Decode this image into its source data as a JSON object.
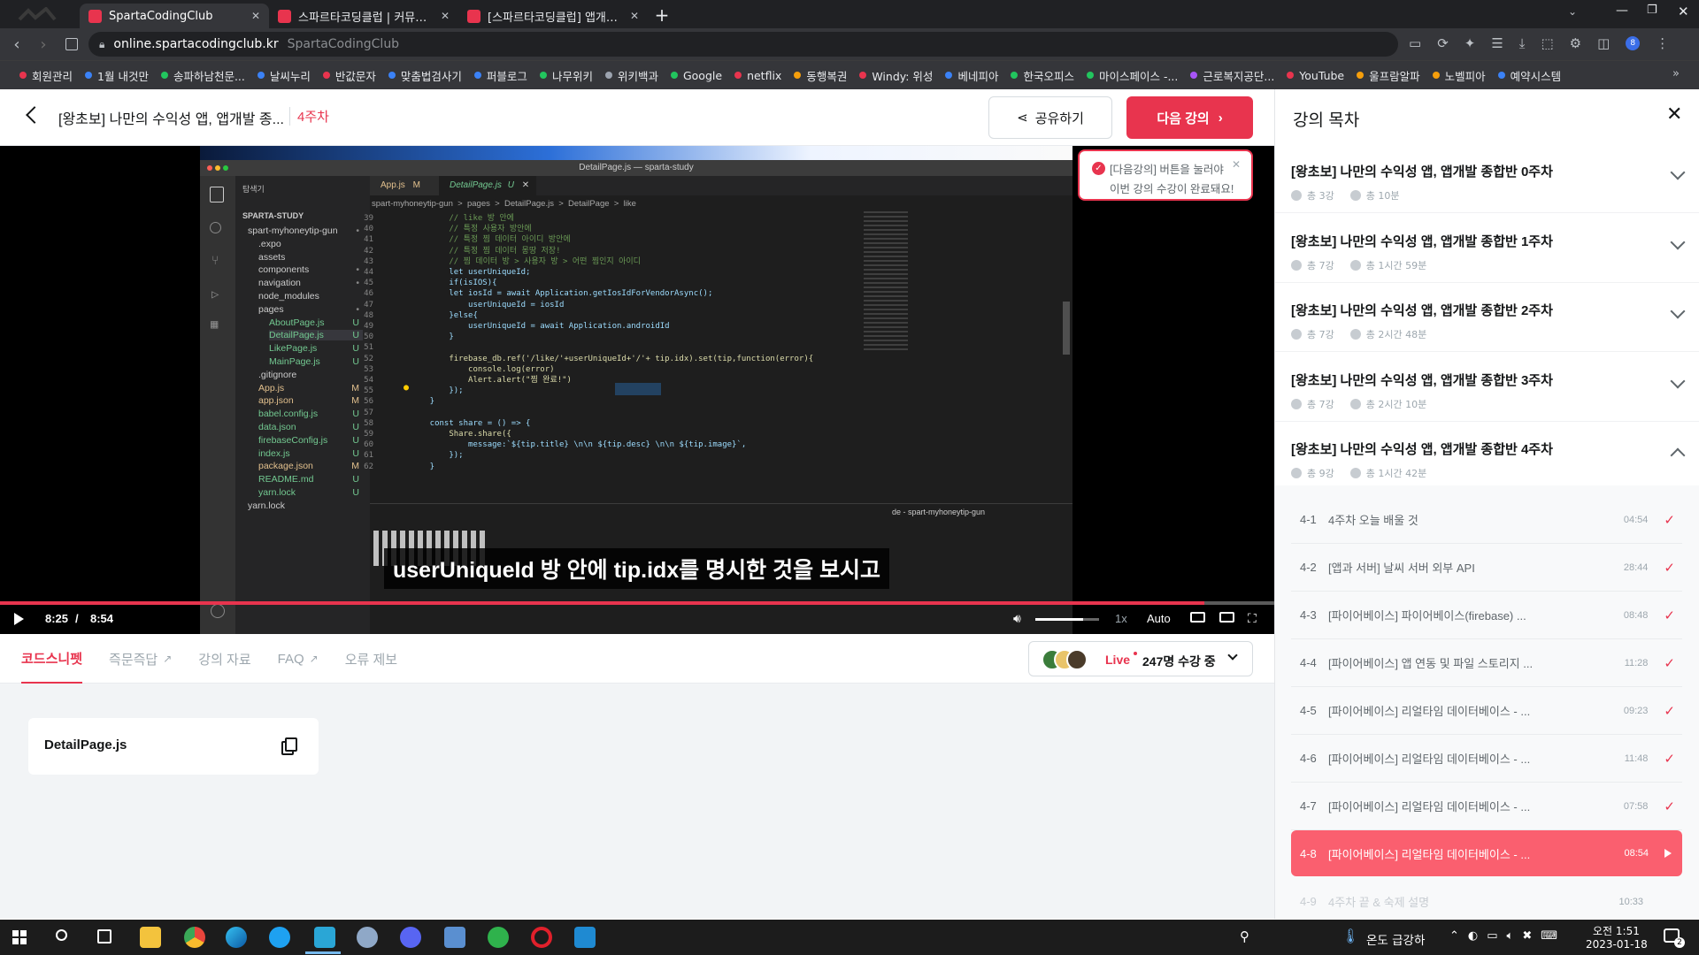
{
  "browser": {
    "tabs": [
      {
        "title": "SpartaCodingClub",
        "active": true,
        "color": "#e8344e"
      },
      {
        "title": "스파르타코딩클럽 | 커뮤니티",
        "active": false,
        "color": "#e8344e"
      },
      {
        "title": "[스파르타코딩클럽] 앱개발 종합",
        "active": false,
        "color": "#e8344e"
      }
    ],
    "url_domain": "online.spartacodingclub.kr",
    "url_site": "SpartaCodingClub",
    "profile_badge": "8",
    "bookmarks": [
      {
        "label": "회원관리",
        "color": "#e8344e"
      },
      {
        "label": "1월 내것만",
        "color": "#3b82f6"
      },
      {
        "label": "송파하남천문...",
        "color": "#22c55e"
      },
      {
        "label": "날씨누리",
        "color": "#3b82f6"
      },
      {
        "label": "반값문자",
        "color": "#e8344e"
      },
      {
        "label": "맞춤법검사기",
        "color": "#3b82f6"
      },
      {
        "label": "퍼블로그",
        "color": "#3b82f6"
      },
      {
        "label": "나무위키",
        "color": "#22c55e"
      },
      {
        "label": "위키백과",
        "color": "#9ca3af"
      },
      {
        "label": "Google",
        "color": "#22c55e"
      },
      {
        "label": "netflix",
        "color": "#e8344e"
      },
      {
        "label": "동행복권",
        "color": "#f59e0b"
      },
      {
        "label": "Windy: 위성",
        "color": "#e8344e"
      },
      {
        "label": "베네피아",
        "color": "#3b82f6"
      },
      {
        "label": "한국오피스",
        "color": "#22c55e"
      },
      {
        "label": "마이스페이스 -...",
        "color": "#22c55e"
      },
      {
        "label": "근로복지공단...",
        "color": "#a855f7"
      },
      {
        "label": "YouTube",
        "color": "#e8344e"
      },
      {
        "label": "울프람알파",
        "color": "#f59e0b"
      },
      {
        "label": "노벨피아",
        "color": "#f59e0b"
      },
      {
        "label": "예약시스템",
        "color": "#3b82f6"
      }
    ]
  },
  "header": {
    "course_title": "[왕초보] 나만의 수익성 앱, 앱개발 종...",
    "week_label": "4주차",
    "share_label": "공유하기",
    "next_label": "다음 강의"
  },
  "tooltip": {
    "line1": "[다음강의] 버튼을 눌러야",
    "line2": "이번 강의 수강이 완료돼요!"
  },
  "vscode": {
    "window_title": "DetailPage.js — sparta-study",
    "explorer_label": "탐색기",
    "project": "SPARTA-STUDY",
    "tabs": [
      {
        "name": "App.js",
        "mark": "M"
      },
      {
        "name": "DetailPage.js",
        "mark": "U"
      }
    ],
    "breadcrumb": "spart-myhoneytip-gun  >  pages  >  DetailPage.js  >  DetailPage  >  like",
    "tree": [
      {
        "name": "spart-myhoneytip-gun",
        "indent": 0,
        "badge": "•"
      },
      {
        "name": ".expo",
        "indent": 1,
        "badge": ""
      },
      {
        "name": "assets",
        "indent": 1,
        "badge": ""
      },
      {
        "name": "components",
        "indent": 1,
        "badge": "•"
      },
      {
        "name": "navigation",
        "indent": 1,
        "badge": "•"
      },
      {
        "name": "node_modules",
        "indent": 1,
        "badge": ""
      },
      {
        "name": "pages",
        "indent": 1,
        "badge": "•"
      },
      {
        "name": "AboutPage.js",
        "indent": 2,
        "badge": "U"
      },
      {
        "name": "DetailPage.js",
        "indent": 2,
        "badge": "U"
      },
      {
        "name": "LikePage.js",
        "indent": 2,
        "badge": "U"
      },
      {
        "name": "MainPage.js",
        "indent": 2,
        "badge": "U"
      },
      {
        "name": ".gitignore",
        "indent": 1,
        "badge": ""
      },
      {
        "name": "App.js",
        "indent": 1,
        "badge": "M"
      },
      {
        "name": "app.json",
        "indent": 1,
        "badge": "M"
      },
      {
        "name": "babel.config.js",
        "indent": 1,
        "badge": "U"
      },
      {
        "name": "data.json",
        "indent": 1,
        "badge": "U"
      },
      {
        "name": "firebaseConfig.js",
        "indent": 1,
        "badge": "U"
      },
      {
        "name": "index.js",
        "indent": 1,
        "badge": "U"
      },
      {
        "name": "package.json",
        "indent": 1,
        "badge": "M"
      },
      {
        "name": "README.md",
        "indent": 1,
        "badge": "U"
      },
      {
        "name": "yarn.lock",
        "indent": 1,
        "badge": "U"
      },
      {
        "name": "yarn.lock",
        "indent": 0,
        "badge": ""
      }
    ],
    "code": [
      {
        "n": "39",
        "text": "        // like 방 안에"
      },
      {
        "n": "40",
        "text": "        // 특정 사용자 방안에"
      },
      {
        "n": "41",
        "text": "        // 특정 찜 데이터 아이디 방안에"
      },
      {
        "n": "42",
        "text": "        // 특정 찜 데이터 몽땅 저장!"
      },
      {
        "n": "43",
        "text": "        // 찜 데이터 방 > 사용자 방 > 어떤 찜인지 아이디"
      },
      {
        "n": "44",
        "text": "        let userUniqueId;"
      },
      {
        "n": "45",
        "text": "        if(isIOS){"
      },
      {
        "n": "46",
        "text": "        let iosId = await Application.getIosIdForVendorAsync();"
      },
      {
        "n": "47",
        "text": "            userUniqueId = iosId"
      },
      {
        "n": "48",
        "text": "        }else{"
      },
      {
        "n": "49",
        "text": "            userUniqueId = await Application.androidId"
      },
      {
        "n": "50",
        "text": "        }"
      },
      {
        "n": "51",
        "text": ""
      },
      {
        "n": "52",
        "text": "        firebase_db.ref('/like/'+userUniqueId+'/'+ tip.idx).set(tip,function(error){"
      },
      {
        "n": "53",
        "text": "            console.log(error)"
      },
      {
        "n": "54",
        "text": "            Alert.alert(\"찜 완료!\")"
      },
      {
        "n": "55",
        "text": "        });"
      },
      {
        "n": "56",
        "text": "    }"
      },
      {
        "n": "57",
        "text": ""
      },
      {
        "n": "58",
        "text": "    const share = () => {"
      },
      {
        "n": "59",
        "text": "        Share.share({"
      },
      {
        "n": "60",
        "text": "            message:`${tip.title} \\n\\n ${tip.desc} \\n\\n ${tip.image}`,"
      },
      {
        "n": "61",
        "text": "        });"
      },
      {
        "n": "62",
        "text": "    }"
      }
    ],
    "terminal_label": "de - spart-myhoneytip-gun"
  },
  "player": {
    "subtitle": "userUniqueId 방 안에 tip.idx를 명시한 것을 보시고",
    "current_time": "8:25",
    "separator": "/",
    "duration": "8:54",
    "progress": 0.945,
    "volume": 0.75,
    "speed": "1x",
    "quality": "Auto"
  },
  "lower_tabs": [
    {
      "label": "코드스니펫",
      "active": true,
      "external": false
    },
    {
      "label": "즉문즉답",
      "active": false,
      "external": true
    },
    {
      "label": "강의 자료",
      "active": false,
      "external": false
    },
    {
      "label": "FAQ",
      "active": false,
      "external": true
    },
    {
      "label": "오류 제보",
      "active": false,
      "external": false
    }
  ],
  "live": {
    "badge": "Live",
    "count_text": "247명 수강 중"
  },
  "snippet": {
    "filename": "DetailPage.js"
  },
  "sidebar": {
    "title": "강의 목차",
    "weeks": [
      {
        "title": "[왕초보] 나만의 수익성 앱, 앱개발 종합반 0주차",
        "lessons": "총 3강",
        "duration": "총 10분",
        "expanded": false
      },
      {
        "title": "[왕초보] 나만의 수익성 앱, 앱개발 종합반 1주차",
        "lessons": "총 7강",
        "duration": "총 1시간 59분",
        "expanded": false
      },
      {
        "title": "[왕초보] 나만의 수익성 앱, 앱개발 종합반 2주차",
        "lessons": "총 7강",
        "duration": "총 2시간 48분",
        "expanded": false
      },
      {
        "title": "[왕초보] 나만의 수익성 앱, 앱개발 종합반 3주차",
        "lessons": "총 7강",
        "duration": "총 2시간 10분",
        "expanded": false
      },
      {
        "title": "[왕초보] 나만의 수익성 앱, 앱개발 종합반 4주차",
        "lessons": "총 9강",
        "duration": "총 1시간 42분",
        "expanded": true
      }
    ],
    "lectures": [
      {
        "num": "4-1",
        "title": "4주차 오늘 배울 것",
        "duration": "04:54",
        "state": "done"
      },
      {
        "num": "4-2",
        "title": "[앱과 서버] 날씨 서버 외부 API",
        "duration": "28:44",
        "state": "done"
      },
      {
        "num": "4-3",
        "title": "[파이어베이스] 파이어베이스(firebase) ...",
        "duration": "08:48",
        "state": "done"
      },
      {
        "num": "4-4",
        "title": "[파이어베이스] 앱 연동 및 파일 스토리지 ...",
        "duration": "11:28",
        "state": "done"
      },
      {
        "num": "4-5",
        "title": "[파이어베이스] 리얼타임 데이터베이스 - ...",
        "duration": "09:23",
        "state": "done"
      },
      {
        "num": "4-6",
        "title": "[파이어베이스] 리얼타임 데이터베이스 - ...",
        "duration": "11:48",
        "state": "done"
      },
      {
        "num": "4-7",
        "title": "[파이어베이스] 리얼타임 데이터베이스 - ...",
        "duration": "07:58",
        "state": "done"
      },
      {
        "num": "4-8",
        "title": "[파이어베이스] 리얼타임 데이터베이스 - ...",
        "duration": "08:54",
        "state": "playing"
      },
      {
        "num": "4-9",
        "title": "4주차 끝 & 숙제 설명",
        "duration": "10:33",
        "state": "locked"
      }
    ]
  },
  "taskbar": {
    "weather": "온도 급강하",
    "time": "오전 1:51",
    "date": "2023-01-18",
    "notif_count": "2"
  },
  "colors": {
    "accent": "#e8344e",
    "active_lecture": "#fa5f6f"
  }
}
